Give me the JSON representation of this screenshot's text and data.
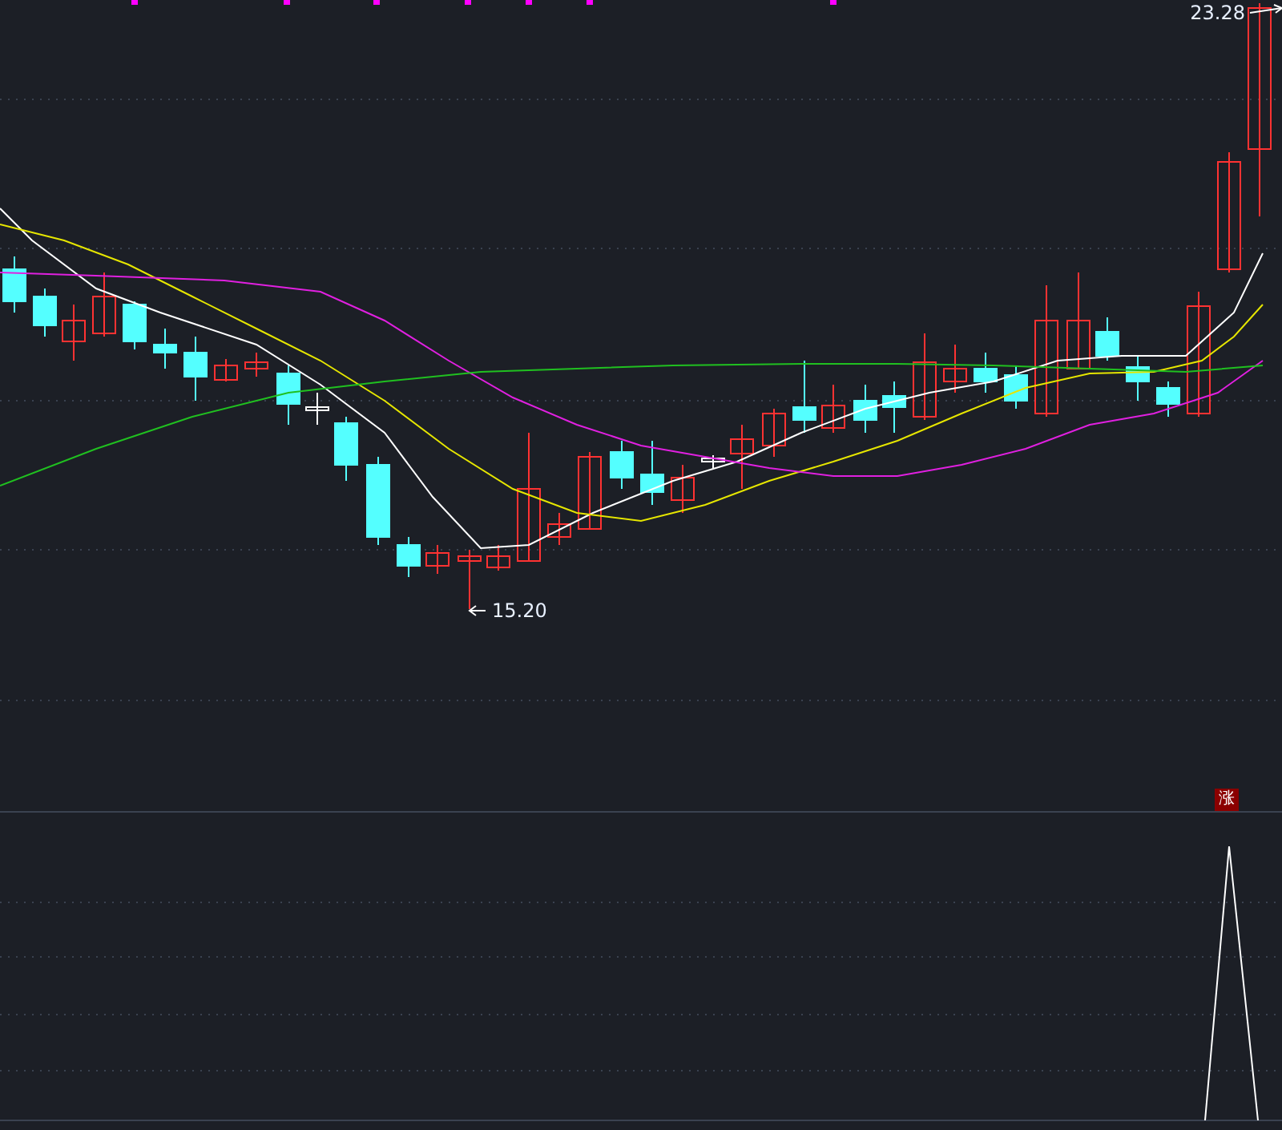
{
  "price_chart": {
    "high_label": "23.28",
    "low_label": "15.20"
  },
  "indicator_panel": {
    "badge": "涨"
  }
}
